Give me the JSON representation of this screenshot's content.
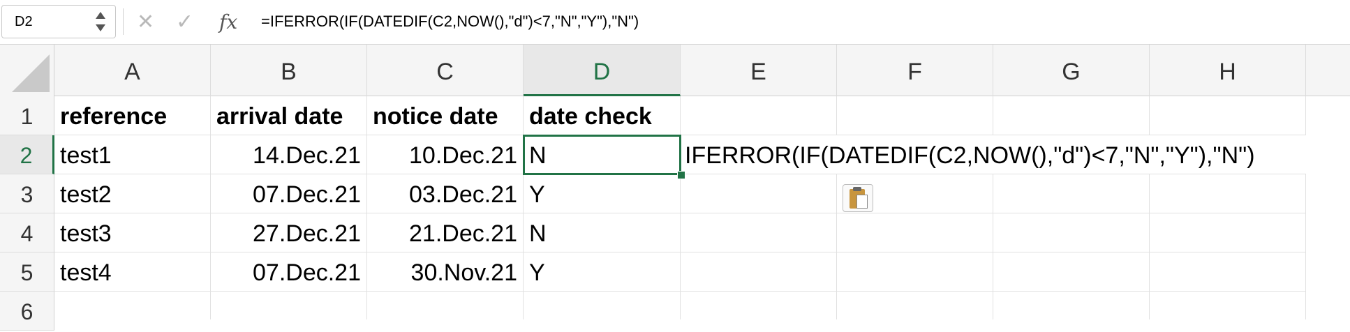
{
  "formula_bar": {
    "name_box": "D2",
    "formula": "=IFERROR(IF(DATEDIF(C2,NOW(),\"d\")<7,\"N\",\"Y\"),\"N\")"
  },
  "columns": [
    "A",
    "B",
    "C",
    "D",
    "E",
    "F",
    "G",
    "H"
  ],
  "rows": [
    "1",
    "2",
    "3",
    "4",
    "5",
    "6"
  ],
  "headers": {
    "reference": "reference",
    "arrival_date": "arrival date",
    "notice_date": "notice date",
    "date_check": "date check"
  },
  "data_rows": [
    {
      "reference": "test1",
      "arrival": "14.Dec.21",
      "notice": "10.Dec.21",
      "check": "N"
    },
    {
      "reference": "test2",
      "arrival": "07.Dec.21",
      "notice": "03.Dec.21",
      "check": "Y"
    },
    {
      "reference": "test3",
      "arrival": "27.Dec.21",
      "notice": "21.Dec.21",
      "check": "N"
    },
    {
      "reference": "test4",
      "arrival": "07.Dec.21",
      "notice": "30.Nov.21",
      "check": "Y"
    }
  ],
  "e2_text": "IFERROR(IF(DATEDIF(C2,NOW(),\"d\")<7,\"N\",\"Y\"),\"N\")",
  "selection": {
    "cell": "D2"
  },
  "icons": {
    "cancel": "close-icon",
    "confirm": "check-icon",
    "function": "fx-icon",
    "paste_options": "clipboard-icon"
  },
  "colors": {
    "accent": "#217346"
  }
}
